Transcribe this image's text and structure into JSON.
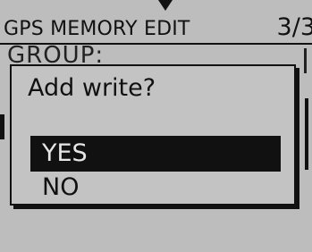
{
  "header": {
    "title": "GPS MEMORY EDIT",
    "page": "3/3"
  },
  "background": {
    "group_label": "GROUP:"
  },
  "dialog": {
    "title": "Add write?",
    "options": [
      {
        "label": "YES",
        "selected": true
      },
      {
        "label": "NO",
        "selected": false
      }
    ]
  },
  "colors": {
    "screen_bg": "#bdbdbd",
    "text": "#111111",
    "selected_bg": "#111111",
    "selected_text": "#e6e6e6"
  }
}
